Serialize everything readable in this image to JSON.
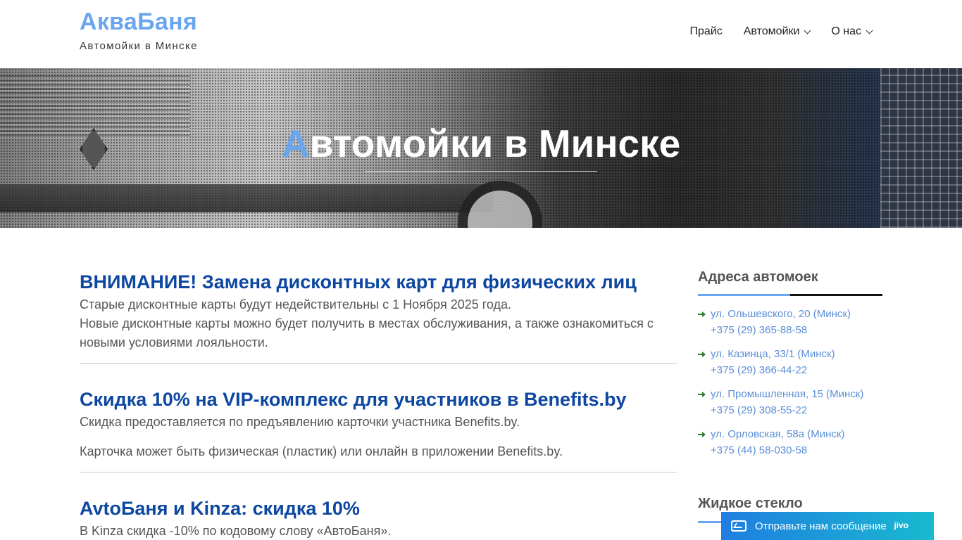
{
  "header": {
    "logo": "АкваБаня",
    "tagline": "Автомойки в Минске",
    "nav": [
      {
        "label": "Прайс",
        "has_dropdown": false
      },
      {
        "label": "Автомойки",
        "has_dropdown": true
      },
      {
        "label": "О нас",
        "has_dropdown": true
      }
    ]
  },
  "hero": {
    "title_accent": "А",
    "title_rest": "втомойки в Минске"
  },
  "posts": [
    {
      "title": "ВНИМАНИЕ! Замена дисконтных карт для физических лиц",
      "lines": [
        "Старые дисконтные карты будут недействительны с 1 Ноября 2025 года.",
        "Новые дисконтные карты можно будет получить в местах обслуживания, а также ознакомиться с новыми условиями лояльности."
      ]
    },
    {
      "title": "Скидка 10% на VIP-комплекс для участников в Benefits.by",
      "lines": [
        "Скидка предоставляется по предъявлению карточки участника Benefits.by.",
        "Карточка может быть физическая (пластик) или онлайн в приложении Benefits.by."
      ]
    },
    {
      "title": "AvtoБаня и Kinza: скидка 10%",
      "lines": [
        "В Kinza скидка -10% по кодовому слову «АвтоБаня»."
      ]
    }
  ],
  "sidebar": {
    "addresses_title": "Адреса автомоек",
    "addresses": [
      {
        "address": "ул. Ольшевского, 20 (Минск)",
        "phone": "+375 (29) 365-88-58"
      },
      {
        "address": "ул. Казинца, 33/1 (Минск)",
        "phone": "+375 (29) 366-44-22"
      },
      {
        "address": "ул. Промышленная, 15 (Минск)",
        "phone": "+375 (29) 308-55-22"
      },
      {
        "address": "ул. Орловская, 58а (Минск)",
        "phone": "+375 (44) 58-030-58"
      }
    ],
    "glass_title": "Жидкое стекло"
  },
  "chat": {
    "label": "Отправьте нам сообщение",
    "brand": "jivo"
  },
  "colors": {
    "accent": "#6aa6f0",
    "post_title": "#0d47a1",
    "link": "#5b8fd8",
    "arrow": "#2e7d32"
  }
}
